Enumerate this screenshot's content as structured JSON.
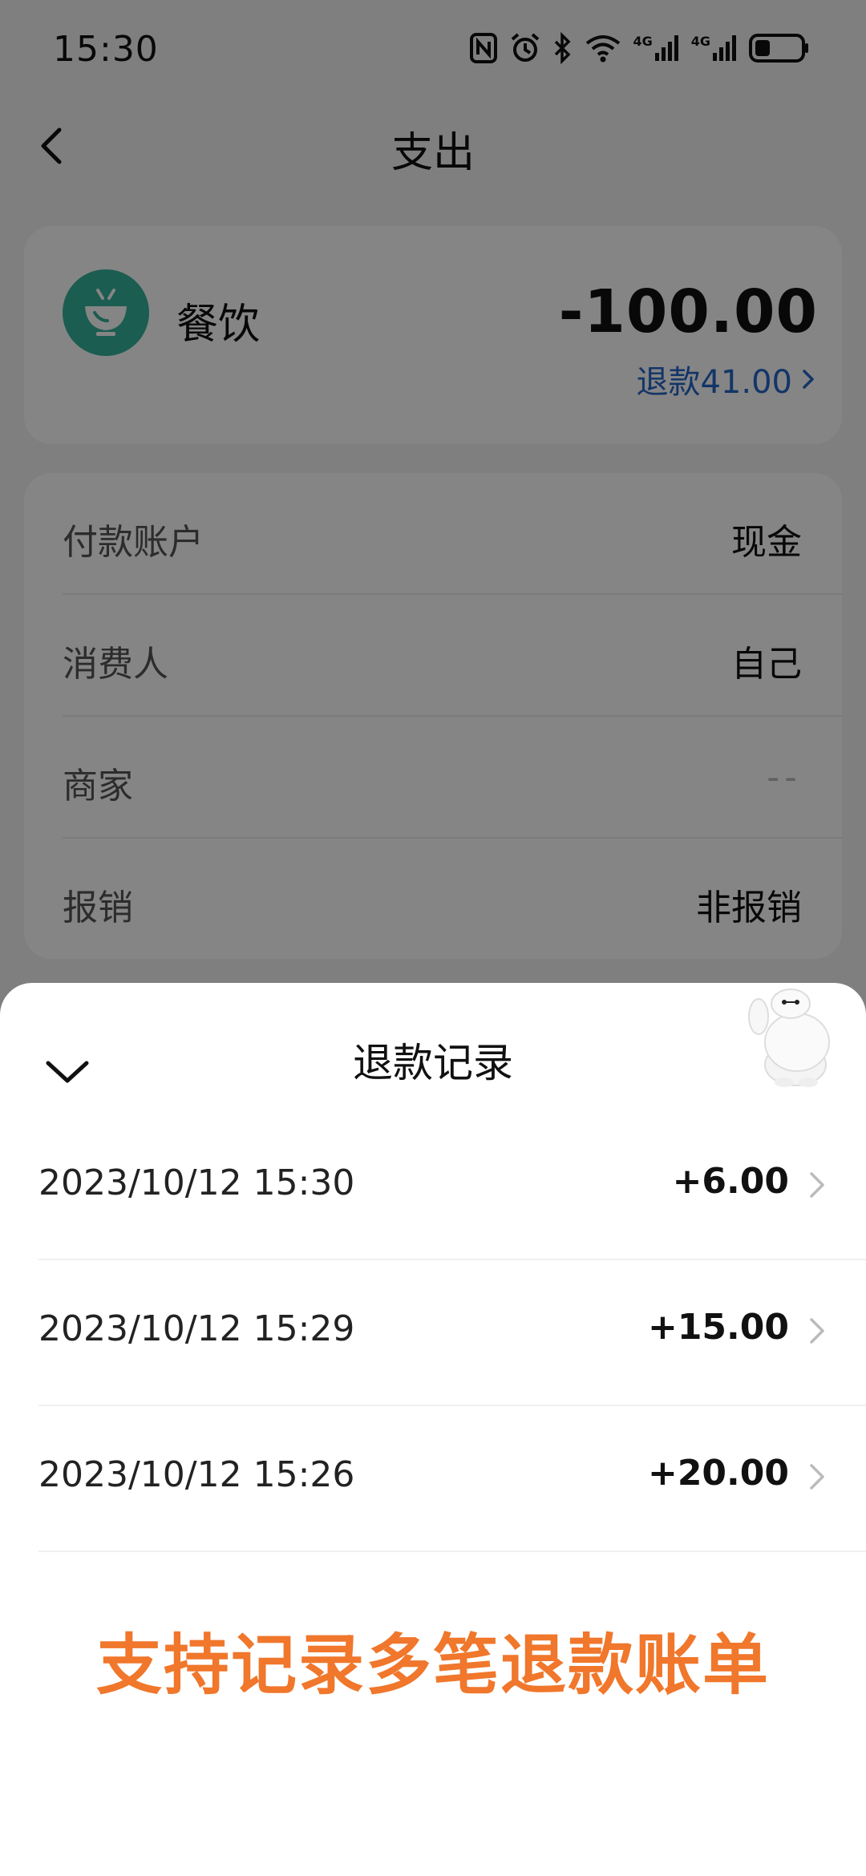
{
  "status_bar": {
    "time": "15:30",
    "network_1": "4G",
    "network_2": "4G"
  },
  "nav": {
    "title": "支出"
  },
  "category": {
    "label": "餐饮",
    "amount": "-100.00",
    "refund_link": "退款41.00",
    "icon_color": "#34b39a"
  },
  "details": [
    {
      "label": "付款账户",
      "value": "现金"
    },
    {
      "label": "消费人",
      "value": "自己"
    },
    {
      "label": "商家",
      "value": "--"
    },
    {
      "label": "报销",
      "value": "非报销"
    }
  ],
  "sheet": {
    "title": "退款记录",
    "records": [
      {
        "time": "2023/10/12 15:30",
        "amount": "+6.00"
      },
      {
        "time": "2023/10/12 15:29",
        "amount": "+15.00"
      },
      {
        "time": "2023/10/12 15:26",
        "amount": "+20.00"
      }
    ],
    "promo": "支持记录多笔退款账单"
  },
  "colors": {
    "accent_blue": "#2566c7",
    "promo_orange": "#f0772b",
    "overlay": "rgba(0,0,0,0.48)"
  }
}
